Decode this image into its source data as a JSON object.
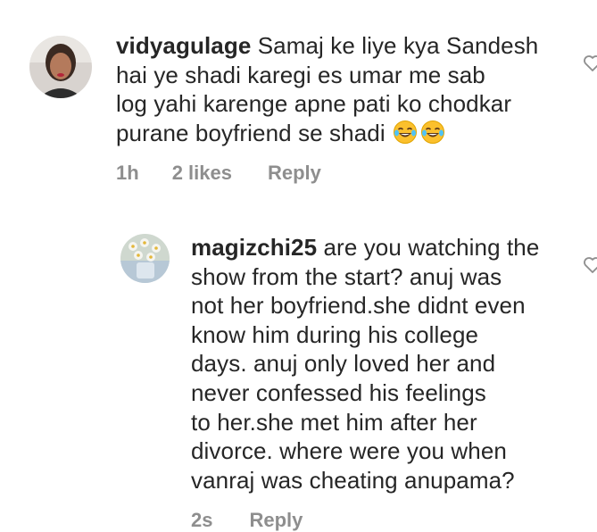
{
  "comments": [
    {
      "username": "vidyagulage",
      "text_lines": [
        "Samaj ke liye kya Sandesh",
        "hai ye shadi karegi es umar me sab",
        "log yahi karenge apne pati ko chodkar",
        "purane boyfriend se shadi"
      ],
      "emoji": [
        "face-with-tears-of-joy",
        "face-with-tears-of-joy"
      ],
      "time": "1h",
      "likes": "2 likes",
      "reply_label": "Reply"
    },
    {
      "username": "magizchi25",
      "text_lines": [
        "are you watching the",
        "show from the start? anuj was",
        "not her boyfriend.she didnt even",
        "know him during his college",
        "days. anuj only loved her and",
        "never confessed his feelings",
        "to her.she met him after her",
        "divorce. where were you when",
        "vanraj was cheating anupama?"
      ],
      "time": "2s",
      "reply_label": "Reply"
    }
  ],
  "icons": {
    "like": "heart-outline-icon"
  },
  "colors": {
    "text": "#262626",
    "meta": "#8e8e8e"
  }
}
